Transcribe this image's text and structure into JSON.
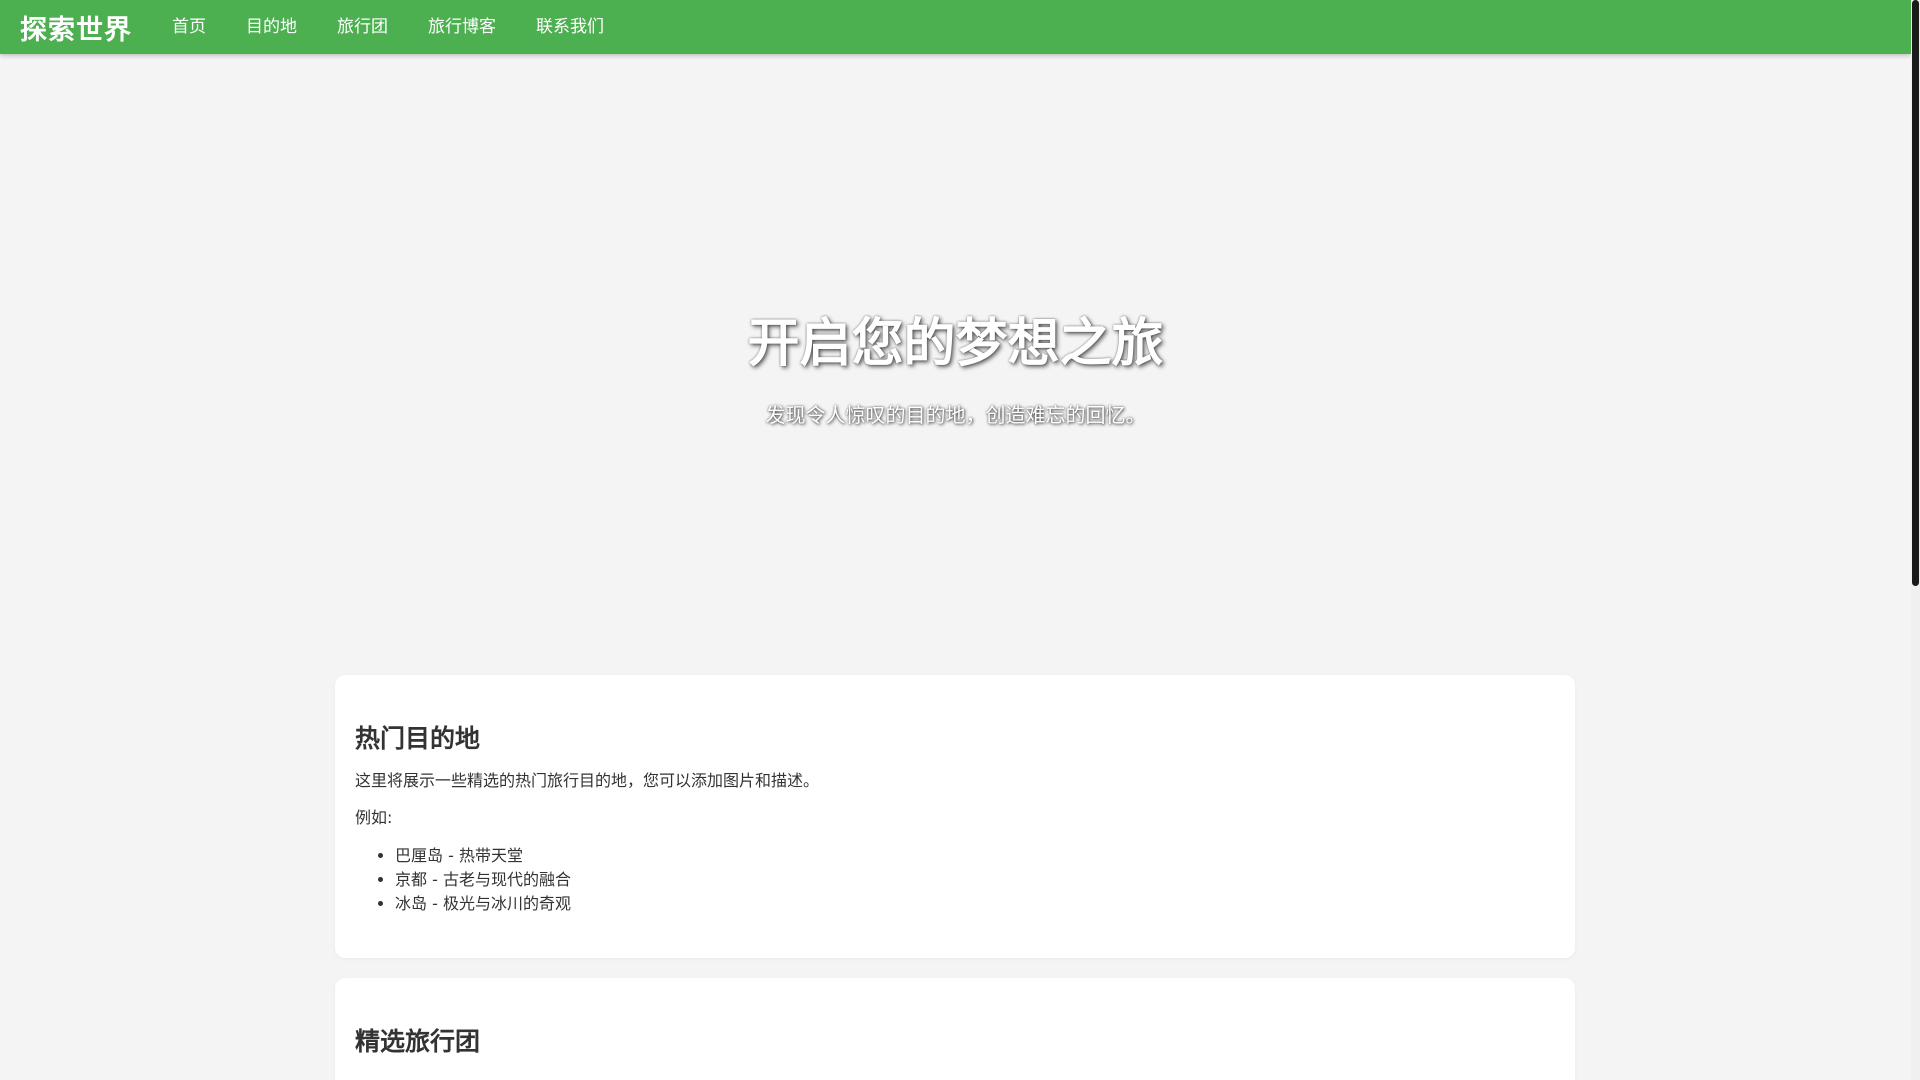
{
  "navbar": {
    "brand": "探索世界",
    "links": [
      {
        "label": "首页"
      },
      {
        "label": "目的地"
      },
      {
        "label": "旅行团"
      },
      {
        "label": "旅行博客"
      },
      {
        "label": "联系我们"
      }
    ],
    "color": "#4caf50"
  },
  "hero": {
    "title": "开启您的梦想之旅",
    "subtitle": "发现令人惊叹的目的地，创造难忘的回忆。"
  },
  "sections": {
    "destinations": {
      "title": "热门目的地",
      "intro": "这里将展示一些精选的热门旅行目的地，您可以添加图片和描述。",
      "example_label": "例如:",
      "items": [
        "巴厘岛 - 热带天堂",
        "京都 - 古老与现代的融合",
        "冰岛 - 极光与冰川的奇观"
      ]
    },
    "tours": {
      "title": "精选旅行团"
    }
  }
}
